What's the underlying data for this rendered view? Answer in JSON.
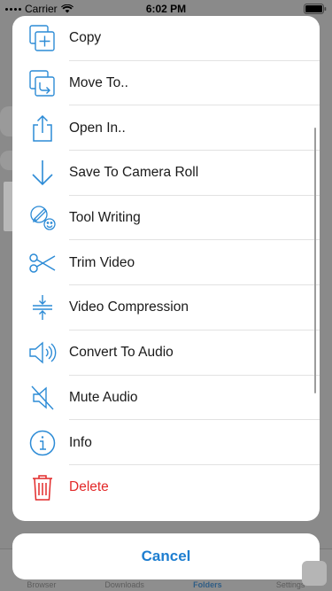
{
  "status_bar": {
    "carrier": "Carrier",
    "time": "6:02 PM"
  },
  "actions": [
    {
      "label": "Copy",
      "icon": "copy-icon"
    },
    {
      "label": "Move To..",
      "icon": "move-to-icon"
    },
    {
      "label": "Open In..",
      "icon": "open-in-icon"
    },
    {
      "label": "Save To Camera Roll",
      "icon": "save-download-icon"
    },
    {
      "label": "Tool Writing",
      "icon": "tool-writing-icon"
    },
    {
      "label": "Trim Video",
      "icon": "scissors-icon"
    },
    {
      "label": "Video Compression",
      "icon": "compression-icon"
    },
    {
      "label": "Convert To Audio",
      "icon": "speaker-icon"
    },
    {
      "label": "Mute Audio",
      "icon": "mute-icon"
    },
    {
      "label": "Info",
      "icon": "info-icon"
    },
    {
      "label": "Delete",
      "icon": "trash-icon"
    }
  ],
  "cancel_label": "Cancel",
  "tab_bar": {
    "items": [
      "Browser",
      "Downloads",
      "Folders",
      "Settings"
    ],
    "active": "Folders"
  },
  "colors": {
    "accent": "#1e7ed0",
    "danger": "#e22a2a",
    "icon": "#2c8bd6"
  }
}
